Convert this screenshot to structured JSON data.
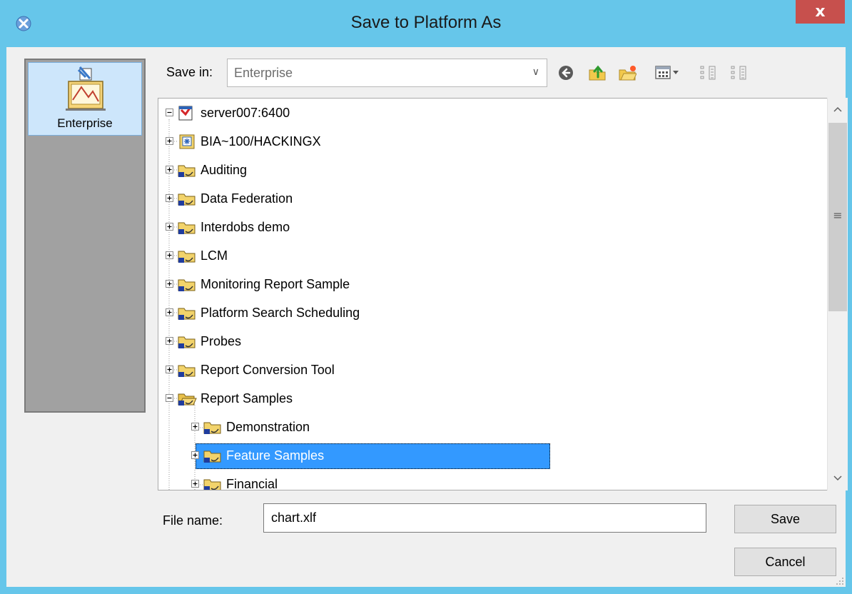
{
  "window": {
    "title": "Save to Platform As",
    "close_label": "x"
  },
  "places": [
    {
      "label": "Enterprise",
      "selected": true
    }
  ],
  "save_in": {
    "label": "Save in:",
    "value": "Enterprise"
  },
  "toolbar": [
    "back-icon",
    "up-folder-icon",
    "new-folder-icon",
    "view-menu-icon",
    "list-view-icon",
    "details-view-icon"
  ],
  "tree": {
    "root": {
      "label": "server007:6400",
      "expanded": true
    },
    "items": [
      {
        "label": "BIA~100/HACKINGX",
        "level": 1,
        "expanded": false,
        "icon": "inbox-icon"
      },
      {
        "label": "Auditing",
        "level": 1,
        "expanded": false,
        "icon": "folder-icon"
      },
      {
        "label": "Data Federation",
        "level": 1,
        "expanded": false,
        "icon": "folder-icon"
      },
      {
        "label": "Interdobs demo",
        "level": 1,
        "expanded": false,
        "icon": "folder-icon"
      },
      {
        "label": "LCM",
        "level": 1,
        "expanded": false,
        "icon": "folder-icon"
      },
      {
        "label": "Monitoring Report Sample",
        "level": 1,
        "expanded": false,
        "icon": "folder-icon"
      },
      {
        "label": "Platform Search Scheduling",
        "level": 1,
        "expanded": false,
        "icon": "folder-icon"
      },
      {
        "label": "Probes",
        "level": 1,
        "expanded": false,
        "icon": "folder-icon"
      },
      {
        "label": "Report Conversion Tool",
        "level": 1,
        "expanded": false,
        "icon": "folder-icon"
      },
      {
        "label": "Report Samples",
        "level": 1,
        "expanded": true,
        "icon": "open-folder-icon"
      },
      {
        "label": "Demonstration",
        "level": 2,
        "expanded": false,
        "icon": "folder-icon"
      },
      {
        "label": "Feature Samples",
        "level": 2,
        "expanded": false,
        "selected": true,
        "icon": "folder-icon"
      },
      {
        "label": "Financial",
        "level": 2,
        "expanded": false,
        "icon": "folder-icon"
      }
    ]
  },
  "file_name": {
    "label": "File name:",
    "value": "chart.xlf"
  },
  "buttons": {
    "save": "Save",
    "cancel": "Cancel"
  },
  "colors": {
    "title_bar": "#66c6ea",
    "selection": "#3399ff",
    "close_button": "#c7504d"
  }
}
